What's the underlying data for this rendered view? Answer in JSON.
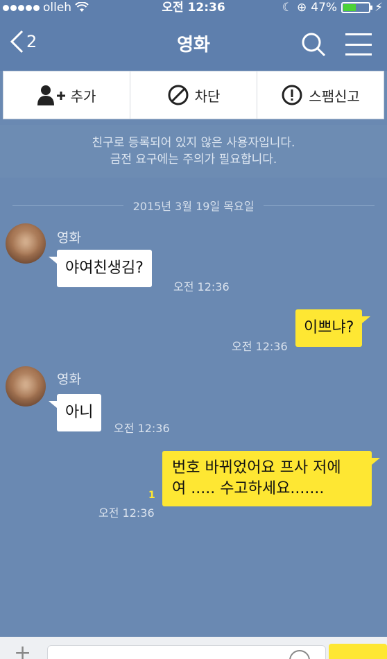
{
  "status_bar": {
    "carrier": "olleh",
    "time": "오전 12:36",
    "battery": "47%",
    "battery_level": 0.47
  },
  "nav": {
    "back_count": "2",
    "title": "영화"
  },
  "actions": [
    {
      "icon": "add-friend-icon",
      "label": "추가"
    },
    {
      "icon": "block-icon",
      "label": "차단"
    },
    {
      "icon": "report-icon",
      "label": "스팸신고"
    }
  ],
  "notice": {
    "line1": "친구로 등록되어 있지 않은 사용자입니다.",
    "line2": "금전 요구에는 주의가 필요합니다."
  },
  "date_divider": "2015년 3월 19일 목요일",
  "messages": [
    {
      "from": "other",
      "sender": "영화",
      "text": "야여친생김?",
      "time": "오전 12:36"
    },
    {
      "from": "me",
      "text": "이쁘냐?",
      "time": "오전 12:36"
    },
    {
      "from": "other",
      "sender": "영화",
      "text": "아니",
      "time": "오전 12:36"
    },
    {
      "from": "me",
      "text_line1": "번호 바뀌었어요 프사 저에",
      "text_line2": "여 ..... 수고하세요.......",
      "time": "오전 12:36",
      "unread": "1"
    }
  ],
  "colors": {
    "background": "#6a89b2",
    "nav": "#5e7fad",
    "my_bubble": "#fee733",
    "other_bubble": "#ffffff"
  }
}
